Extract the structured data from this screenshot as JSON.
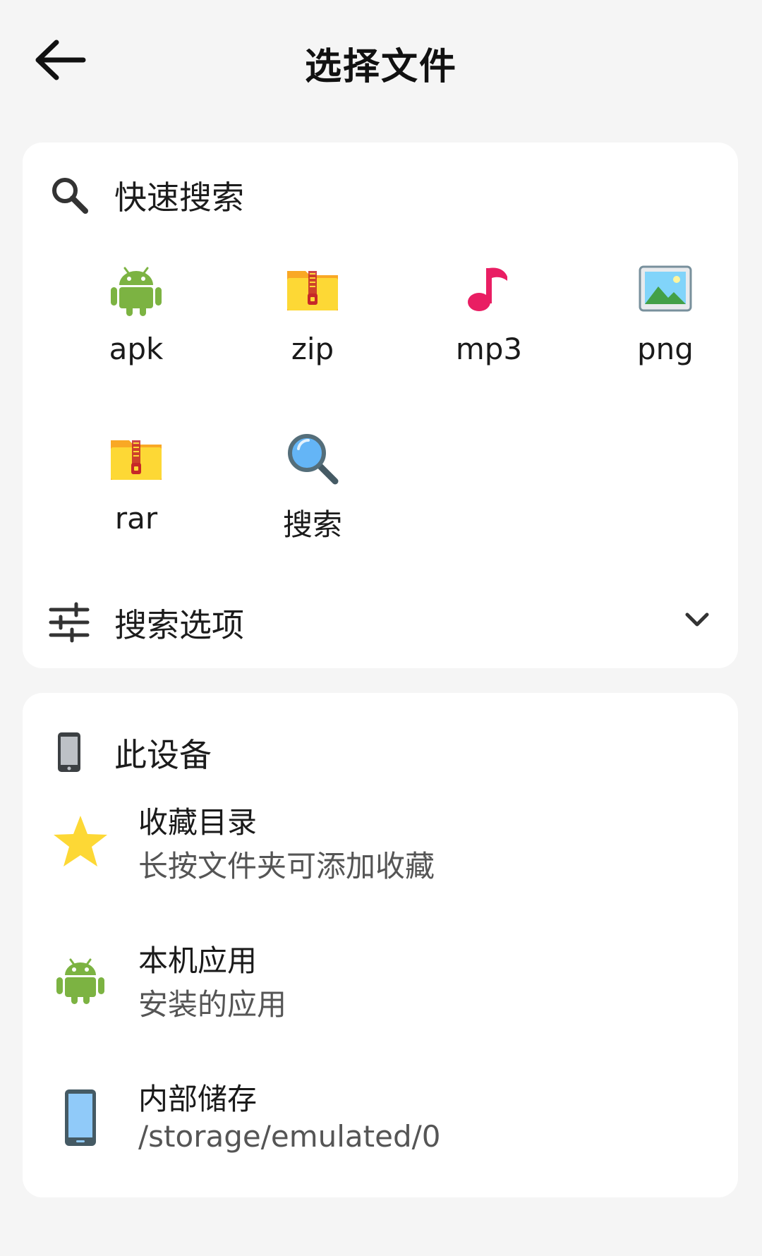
{
  "header": {
    "title": "选择文件",
    "back_icon": "arrow-left-icon"
  },
  "quick_search": {
    "title": "快速搜索",
    "icon": "search-icon",
    "items": [
      {
        "label": "apk",
        "icon": "android-icon"
      },
      {
        "label": "zip",
        "icon": "zip-folder-icon"
      },
      {
        "label": "mp3",
        "icon": "music-note-icon"
      },
      {
        "label": "png",
        "icon": "image-icon"
      },
      {
        "label": "rar",
        "icon": "zip-folder-icon"
      },
      {
        "label": "搜索",
        "icon": "magnifier-icon"
      }
    ],
    "options_label": "搜索选项",
    "options_icon": "tune-sliders-icon"
  },
  "device": {
    "title": "此设备",
    "icon": "phone-icon",
    "items": [
      {
        "title": "收藏目录",
        "subtitle": "长按文件夹可添加收藏",
        "icon": "star-icon"
      },
      {
        "title": "本机应用",
        "subtitle": "安装的应用",
        "icon": "android-icon"
      },
      {
        "title": "内部储存",
        "subtitle": "/storage/emulated/0",
        "icon": "phone-storage-icon"
      }
    ]
  },
  "colors": {
    "background": "#f5f5f5",
    "card": "#ffffff",
    "android_green": "#7cb342",
    "folder_yellow": "#fbc02d",
    "music_pink": "#e91e63",
    "star_yellow": "#fdd835"
  }
}
